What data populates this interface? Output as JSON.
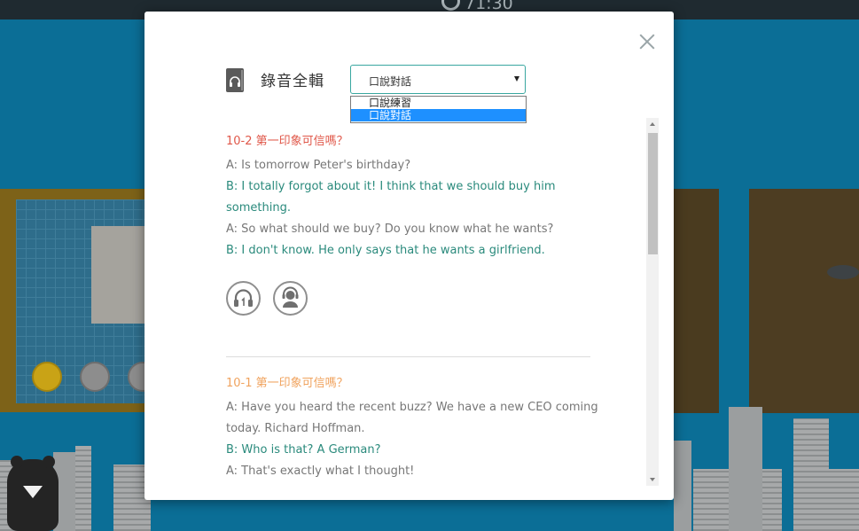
{
  "topbar": {
    "timer": "71:30"
  },
  "modal": {
    "header_title": "錄音全輯",
    "select": {
      "selected": "口說對話",
      "options": [
        "口說練習",
        "口說對話"
      ]
    },
    "sections": [
      {
        "title": "10-2 第一印象可信嗎？",
        "title_color": "#e0584a",
        "lines": [
          {
            "speaker": "a",
            "text": "A: Is tomorrow Peter's birthday?"
          },
          {
            "speaker": "b",
            "text": "B: I totally forgot about it! I think that we should buy him"
          },
          {
            "speaker": "b",
            "text": "something."
          },
          {
            "speaker": "a",
            "text": "A: So what should we buy? Do you know what he wants?"
          },
          {
            "speaker": "b",
            "text": "B: I don't know. He only says that he wants a girlfriend."
          }
        ]
      },
      {
        "title": "10-1 第一印象可信嗎？",
        "title_color": "#f0a35e",
        "lines": [
          {
            "speaker": "a",
            "text": "A: Have you heard the recent buzz? We have a new CEO coming"
          },
          {
            "speaker": "a",
            "text": "today. Richard Hoffman."
          },
          {
            "speaker": "b",
            "text": "B: Who is that? A German?"
          },
          {
            "speaker": "a",
            "text": "A: That's exactly what I thought!"
          }
        ]
      }
    ]
  },
  "colors": {
    "accent_teal": "#2a8a7c",
    "select_border": "#39a7a0",
    "dropdown_highlight": "#1e90ff"
  }
}
